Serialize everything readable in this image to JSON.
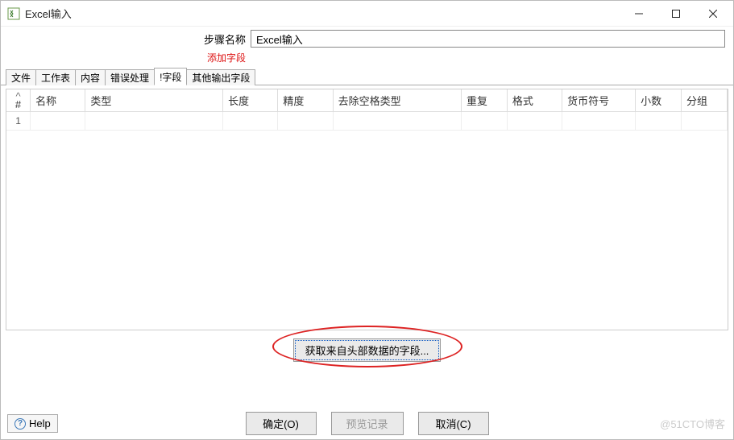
{
  "window": {
    "title": "Excel输入"
  },
  "form": {
    "step_name_label": "步骤名称",
    "step_name_value": "Excel输入",
    "add_fields_label": "添加字段"
  },
  "tabs": [
    {
      "label": "文件"
    },
    {
      "label": "工作表"
    },
    {
      "label": "内容"
    },
    {
      "label": "错误处理"
    },
    {
      "label": "!字段",
      "active": true
    },
    {
      "label": "其他输出字段"
    }
  ],
  "grid": {
    "columns": [
      "#",
      "名称",
      "类型",
      "长度",
      "精度",
      "去除空格类型",
      "重复",
      "格式",
      "货币符号",
      "小数",
      "分组"
    ],
    "rows": [
      {
        "num": "1"
      }
    ]
  },
  "buttons": {
    "get_fields": "获取来自头部数据的字段...",
    "help": "Help",
    "ok": "确定(O)",
    "preview": "预览记录",
    "cancel": "取消(C)"
  },
  "watermark": "@51CTO博客"
}
